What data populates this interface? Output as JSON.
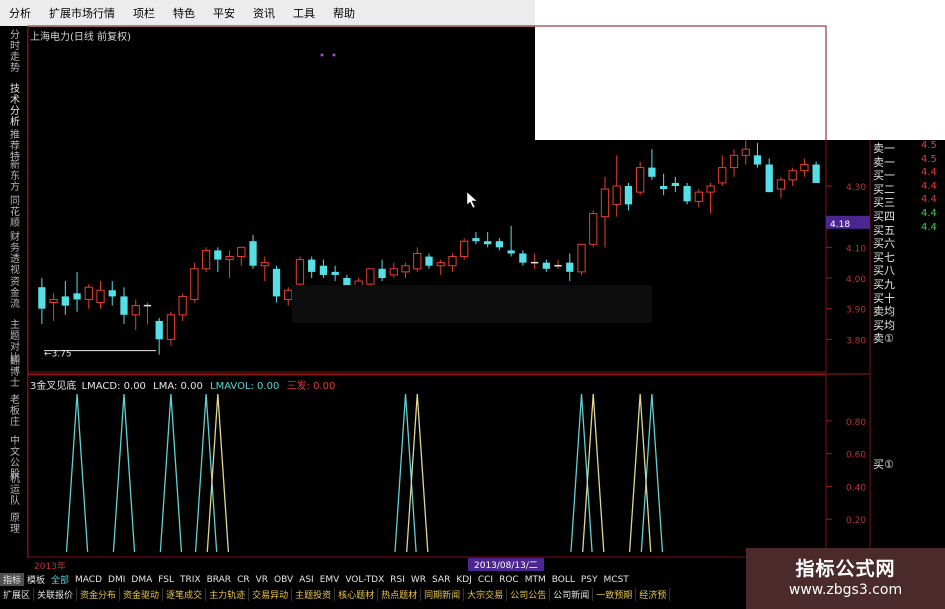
{
  "menu": [
    "分析",
    "扩展市场行情",
    "项栏",
    "特色",
    "平安",
    "资讯",
    "工具",
    "帮助"
  ],
  "left_tabs": [
    {
      "label": "分时走势",
      "top": 30,
      "active": false
    },
    {
      "label": "技术分析",
      "top": 84,
      "active": true
    },
    {
      "label": "推荐特",
      "top": 130,
      "active": false
    },
    {
      "label": "新东方",
      "top": 160,
      "active": false
    },
    {
      "label": "同花顺",
      "top": 196,
      "active": false
    },
    {
      "label": "财务透视",
      "top": 232,
      "active": false
    },
    {
      "label": "资金流",
      "top": 277,
      "active": false
    },
    {
      "label": "主题对比",
      "top": 320,
      "active": false
    },
    {
      "label": "翻博士",
      "top": 356,
      "active": false
    },
    {
      "label": "老板庄",
      "top": 395,
      "active": false
    },
    {
      "label": "中文公股",
      "top": 436,
      "active": false
    },
    {
      "label": "机运队",
      "top": 474,
      "active": false
    },
    {
      "label": "原理",
      "top": 513,
      "active": false
    }
  ],
  "stock_title": "上海电力(日线 前复权)",
  "price_axis": [
    "4.30",
    "4.18",
    "4.10",
    "4.00",
    "3.90",
    "3.80"
  ],
  "current_price": "4.18",
  "low_marker": "3.75",
  "indicator_title": {
    "name": "3金叉见底",
    "lmacd": "LMACD: 0.00",
    "lma": "LMA: 0.00",
    "lmavol": "LMAVOL: 0.00",
    "extra": "三发: 0.00"
  },
  "indicator_axis": [
    "0.80",
    "0.60",
    "0.40",
    "0.20"
  ],
  "date_labels": {
    "left": "2013年",
    "center": "2013/08/13/二"
  },
  "order_book": [
    {
      "label": "卖一",
      "price": "4.5",
      "color": "#e43b3b"
    },
    {
      "label": "卖一",
      "price": "4.5",
      "color": "#e43b3b"
    },
    {
      "label": "买一",
      "price": "4.4",
      "color": "#e43b3b"
    },
    {
      "label": "买二",
      "price": "4.4",
      "color": "#e43b3b"
    },
    {
      "label": "买三",
      "price": "4.4",
      "color": "#e43b3b"
    },
    {
      "label": "买四",
      "price": "4.4",
      "color": "#3bd43b"
    },
    {
      "label": "买五",
      "price": "4.4",
      "color": "#3bd43b"
    },
    {
      "label": "买六",
      "price": "",
      "color": "#e43b3b"
    },
    {
      "label": "买七",
      "price": "",
      "color": "#e43b3b"
    },
    {
      "label": "买八",
      "price": "",
      "color": "#e43b3b"
    },
    {
      "label": "买九",
      "price": "",
      "color": "#e43b3b"
    },
    {
      "label": "买十",
      "price": "",
      "color": "#e43b3b"
    },
    {
      "label": "卖均",
      "price": "",
      "color": "#e43b3b"
    },
    {
      "label": "买均",
      "price": "",
      "color": "#e43b3b"
    },
    {
      "label": "卖①",
      "price": "",
      "color": "#e43b3b"
    }
  ],
  "side_label": "买①",
  "indicator_tabs": [
    "指标",
    "模板",
    "全部",
    "MACD",
    "DMI",
    "DMA",
    "FSL",
    "TRIX",
    "BRAR",
    "CR",
    "VR",
    "OBV",
    "ASI",
    "EMV",
    "VOL-TDX",
    "RSI",
    "WR",
    "SAR",
    "KDJ",
    "CCI",
    "ROC",
    "MTM",
    "BOLL",
    "PSY",
    "MCST"
  ],
  "function_tabs": [
    "扩展区",
    "关联报价",
    "资金分布",
    "资金驱动",
    "逐笔成交",
    "主力轨迹",
    "交易异动",
    "主题投资",
    "核心题材",
    "热点题材",
    "同期新闻",
    "大宗交易",
    "公司公告",
    "公司新闻",
    "一致预期",
    "经济预"
  ],
  "watermark": {
    "title": "指标公式网",
    "url": "www.zbgs3.com"
  },
  "chart_data": {
    "type": "candlestick",
    "candles": [
      {
        "o": 3.97,
        "h": 4.0,
        "l": 3.85,
        "c": 3.9
      },
      {
        "o": 3.92,
        "h": 3.95,
        "l": 3.86,
        "c": 3.93
      },
      {
        "o": 3.94,
        "h": 3.99,
        "l": 3.88,
        "c": 3.91
      },
      {
        "o": 3.95,
        "h": 4.02,
        "l": 3.89,
        "c": 3.93
      },
      {
        "o": 3.93,
        "h": 3.98,
        "l": 3.9,
        "c": 3.97
      },
      {
        "o": 3.92,
        "h": 3.99,
        "l": 3.9,
        "c": 3.96
      },
      {
        "o": 3.96,
        "h": 3.99,
        "l": 3.91,
        "c": 3.94
      },
      {
        "o": 3.94,
        "h": 3.97,
        "l": 3.85,
        "c": 3.88
      },
      {
        "o": 3.88,
        "h": 3.93,
        "l": 3.83,
        "c": 3.91
      },
      {
        "o": 3.91,
        "h": 3.92,
        "l": 3.85,
        "c": 3.91
      },
      {
        "o": 3.86,
        "h": 3.87,
        "l": 3.75,
        "c": 3.8
      },
      {
        "o": 3.8,
        "h": 3.89,
        "l": 3.78,
        "c": 3.88
      },
      {
        "o": 3.88,
        "h": 3.95,
        "l": 3.86,
        "c": 3.94
      },
      {
        "o": 3.93,
        "h": 4.05,
        "l": 3.92,
        "c": 4.03
      },
      {
        "o": 4.03,
        "h": 4.1,
        "l": 4.02,
        "c": 4.09
      },
      {
        "o": 4.09,
        "h": 4.1,
        "l": 4.02,
        "c": 4.06
      },
      {
        "o": 4.06,
        "h": 4.09,
        "l": 4.0,
        "c": 4.07
      },
      {
        "o": 4.07,
        "h": 4.1,
        "l": 4.04,
        "c": 4.1
      },
      {
        "o": 4.12,
        "h": 4.14,
        "l": 4.03,
        "c": 4.04
      },
      {
        "o": 4.04,
        "h": 4.07,
        "l": 3.99,
        "c": 4.05
      },
      {
        "o": 4.03,
        "h": 4.04,
        "l": 3.92,
        "c": 3.94
      },
      {
        "o": 3.93,
        "h": 3.97,
        "l": 3.91,
        "c": 3.96
      },
      {
        "o": 3.98,
        "h": 4.07,
        "l": 3.97,
        "c": 4.06
      },
      {
        "o": 4.06,
        "h": 4.07,
        "l": 4.0,
        "c": 4.02
      },
      {
        "o": 4.04,
        "h": 4.06,
        "l": 4.0,
        "c": 4.01
      },
      {
        "o": 4.02,
        "h": 4.04,
        "l": 3.99,
        "c": 4.01
      },
      {
        "o": 4.0,
        "h": 4.01,
        "l": 3.95,
        "c": 3.96
      },
      {
        "o": 3.96,
        "h": 4.0,
        "l": 3.95,
        "c": 3.99
      },
      {
        "o": 3.98,
        "h": 4.03,
        "l": 3.97,
        "c": 4.03
      },
      {
        "o": 4.03,
        "h": 4.06,
        "l": 3.99,
        "c": 4.0
      },
      {
        "o": 4.01,
        "h": 4.05,
        "l": 4.0,
        "c": 4.03
      },
      {
        "o": 4.02,
        "h": 4.05,
        "l": 4.0,
        "c": 4.04
      },
      {
        "o": 4.03,
        "h": 4.1,
        "l": 4.02,
        "c": 4.08
      },
      {
        "o": 4.07,
        "h": 4.08,
        "l": 4.03,
        "c": 4.04
      },
      {
        "o": 4.04,
        "h": 4.06,
        "l": 4.01,
        "c": 4.05
      },
      {
        "o": 4.04,
        "h": 4.08,
        "l": 4.02,
        "c": 4.07
      },
      {
        "o": 4.07,
        "h": 4.13,
        "l": 4.06,
        "c": 4.12
      },
      {
        "o": 4.13,
        "h": 4.15,
        "l": 4.11,
        "c": 4.12
      },
      {
        "o": 4.12,
        "h": 4.15,
        "l": 4.1,
        "c": 4.11
      },
      {
        "o": 4.12,
        "h": 4.13,
        "l": 4.09,
        "c": 4.1
      },
      {
        "o": 4.09,
        "h": 4.17,
        "l": 4.07,
        "c": 4.08
      },
      {
        "o": 4.08,
        "h": 4.09,
        "l": 4.04,
        "c": 4.05
      },
      {
        "o": 4.05,
        "h": 4.08,
        "l": 4.03,
        "c": 4.05
      },
      {
        "o": 4.05,
        "h": 4.06,
        "l": 4.02,
        "c": 4.03
      },
      {
        "o": 4.04,
        "h": 4.06,
        "l": 4.03,
        "c": 4.04
      },
      {
        "o": 4.05,
        "h": 4.08,
        "l": 3.99,
        "c": 4.02
      },
      {
        "o": 4.02,
        "h": 4.11,
        "l": 4.01,
        "c": 4.11
      },
      {
        "o": 4.11,
        "h": 4.22,
        "l": 4.1,
        "c": 4.21
      },
      {
        "o": 4.2,
        "h": 4.33,
        "l": 4.1,
        "c": 4.29
      },
      {
        "o": 4.24,
        "h": 4.4,
        "l": 4.2,
        "c": 4.3
      },
      {
        "o": 4.3,
        "h": 4.31,
        "l": 4.22,
        "c": 4.24
      },
      {
        "o": 4.28,
        "h": 4.38,
        "l": 4.27,
        "c": 4.36
      },
      {
        "o": 4.36,
        "h": 4.42,
        "l": 4.32,
        "c": 4.33
      },
      {
        "o": 4.3,
        "h": 4.34,
        "l": 4.27,
        "c": 4.29
      },
      {
        "o": 4.31,
        "h": 4.33,
        "l": 4.28,
        "c": 4.3
      },
      {
        "o": 4.3,
        "h": 4.31,
        "l": 4.24,
        "c": 4.25
      },
      {
        "o": 4.25,
        "h": 4.29,
        "l": 4.23,
        "c": 4.28
      },
      {
        "o": 4.28,
        "h": 4.31,
        "l": 4.21,
        "c": 4.3
      },
      {
        "o": 4.31,
        "h": 4.4,
        "l": 4.3,
        "c": 4.36
      },
      {
        "o": 4.36,
        "h": 4.42,
        "l": 4.33,
        "c": 4.4
      },
      {
        "o": 4.4,
        "h": 4.45,
        "l": 4.37,
        "c": 4.42
      },
      {
        "o": 4.4,
        "h": 4.44,
        "l": 4.36,
        "c": 4.37
      },
      {
        "o": 4.37,
        "h": 4.39,
        "l": 4.28,
        "c": 4.28
      },
      {
        "o": 4.29,
        "h": 4.33,
        "l": 4.26,
        "c": 4.32
      },
      {
        "o": 4.32,
        "h": 4.36,
        "l": 4.3,
        "c": 4.35
      },
      {
        "o": 4.35,
        "h": 4.39,
        "l": 4.33,
        "c": 4.37
      },
      {
        "o": 4.37,
        "h": 4.38,
        "l": 4.31,
        "c": 4.31
      }
    ],
    "ylim": [
      3.7,
      4.45
    ],
    "indicator": {
      "series": [
        {
          "color": "#5fd3d3",
          "peaks": [
            3,
            7,
            11,
            14,
            31,
            46,
            52
          ]
        },
        {
          "color": "#e0d890",
          "peaks": [
            15,
            32,
            47,
            51
          ]
        }
      ],
      "ylim": [
        0,
        1
      ]
    }
  }
}
